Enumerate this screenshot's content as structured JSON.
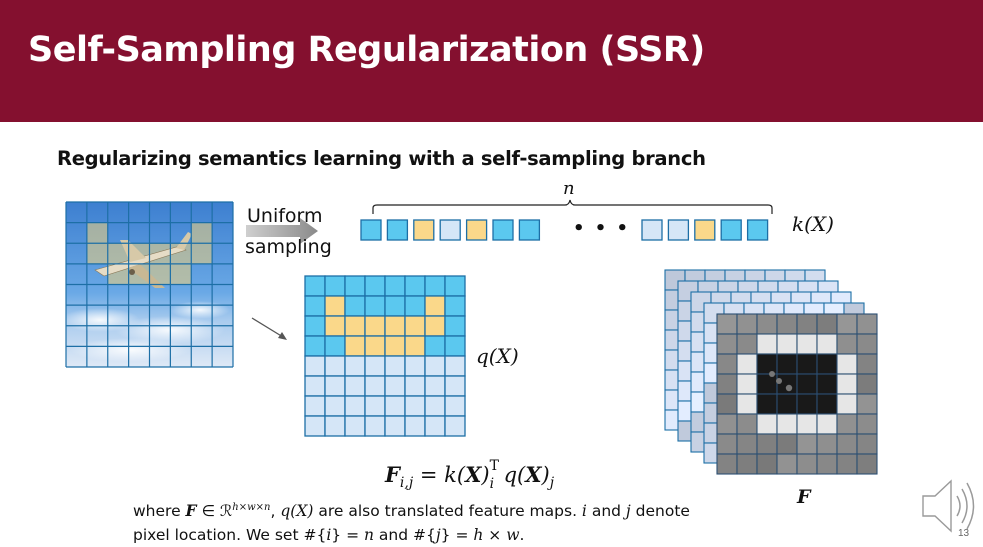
{
  "slide": {
    "title": "Self-Sampling Regularization (SSR)",
    "subtitle": "Regularizing semantics learning with a self-sampling branch",
    "page_number": "13"
  },
  "diagram": {
    "sampling_label_line1": "Uniform",
    "sampling_label_line2": "sampling",
    "n_label": "n",
    "k_label": "k(X)",
    "q_label": "q(X)",
    "F_label": "F",
    "ellipsis": "• • •",
    "equation": "F_{i,j} = k(X)_i^T q(X)_j",
    "equation_lhs": "F",
    "equation_lhs_sub": "i,j",
    "equation_eq": " = k(",
    "equation_X1": "X",
    "equation_mid": ")",
    "equation_sub_i": "i",
    "equation_sup_T": "T",
    "equation_q": "q(",
    "equation_X2": "X",
    "equation_close": ")",
    "equation_sub_j": "j"
  },
  "caption": {
    "line1": "where F ∈ ℛ^{h×w×n}, q(X) are also translated feature maps. i and j denote",
    "line2": "pixel location. We set #{i} = n and #{j} = h × w.",
    "l1_a": "where ",
    "l1_F": "F",
    "l1_in": " ∈ ℛ",
    "l1_sup": "h×w×n",
    "l1_b": ", ",
    "l1_q": "q(X)",
    "l1_c": " are also translated feature maps. ",
    "l1_i": "i",
    "l1_d": " and ",
    "l1_j": "j",
    "l1_e": " denote",
    "l2_a": "pixel location. We set #{",
    "l2_i": "i",
    "l2_b": "} = ",
    "l2_n": "n",
    "l2_c": " and #{",
    "l2_j": "j",
    "l2_d": "} = ",
    "l2_h": "h",
    "l2_x": " × ",
    "l2_w": "w",
    "l2_e": "."
  },
  "colors": {
    "header": "#84102f",
    "cyan_cell": "#5bc8ef",
    "yellow_cell": "#fad88a",
    "light_cell": "#d5e6f7",
    "grid_line": "#1d6fa6"
  },
  "icons": {
    "speaker": "speaker-icon"
  }
}
